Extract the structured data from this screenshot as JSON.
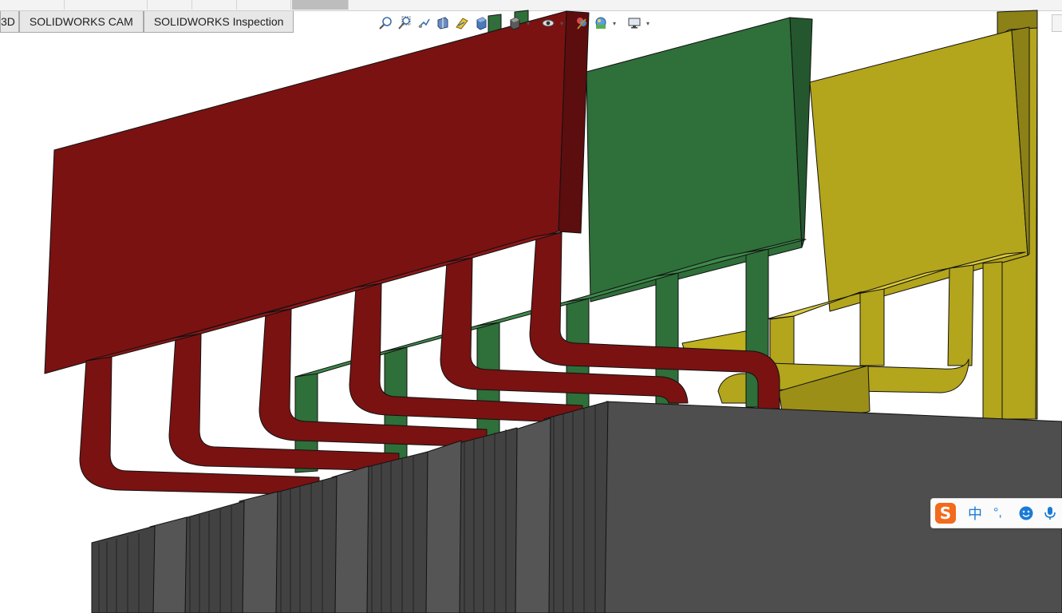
{
  "command_manager": {
    "tabs": [
      {
        "label": "3D"
      },
      {
        "label": "SOLIDWORKS CAM"
      },
      {
        "label": "SOLIDWORKS Inspection"
      }
    ]
  },
  "view_toolbar": {
    "icons": [
      "zoom-to-fit-icon",
      "zoom-to-area-icon",
      "previous-view-icon",
      "section-view-icon",
      "dynamic-annotation-icon",
      "view-orientation-icon",
      "display-style-icon",
      "hide-show-items-icon",
      "edit-appearance-icon",
      "apply-scene-icon",
      "view-settings-icon"
    ]
  },
  "model": {
    "part_colors": {
      "red": "#7a1212",
      "green": "#2f6f3a",
      "yellow": "#b3a51c",
      "gray": "#4e4e4e"
    }
  },
  "ime_bar": {
    "logo_letter": "S",
    "language": "中",
    "punctuation": "°,"
  }
}
